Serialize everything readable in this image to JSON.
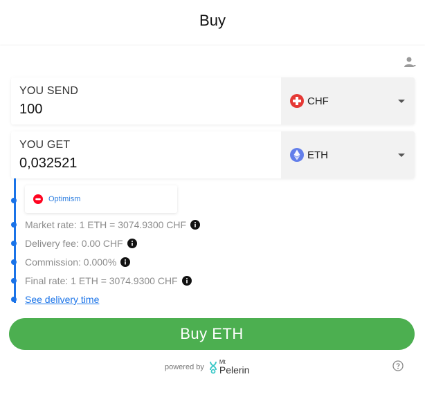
{
  "header": {
    "title": "Buy"
  },
  "send": {
    "label": "YOU SEND",
    "amount": "100",
    "currency": "CHF",
    "currency_icon": "swiss-flag-icon"
  },
  "get": {
    "label": "YOU GET",
    "amount": "0,032521",
    "currency": "ETH",
    "currency_icon": "ethereum-icon"
  },
  "network": {
    "name": "Optimism",
    "icon": "optimism-icon"
  },
  "details": {
    "market_rate": "Market rate: 1 ETH = 3074.9300 CHF",
    "delivery_fee": "Delivery fee: 0.00 CHF",
    "commission": "Commission: 0.000%",
    "final_rate": "Final rate: 1 ETH = 3074.9300 CHF",
    "delivery_time_link": "See delivery time"
  },
  "buy_button": {
    "label": "Buy ETH"
  },
  "footer": {
    "powered_by": "powered by",
    "brand_mt": "Mt",
    "brand_name": "Pelerin"
  },
  "colors": {
    "accent": "#1a73e8",
    "button": "#4caf50",
    "chf_red": "#e53935",
    "eth_blue": "#627eea",
    "op_red": "#ff0420"
  }
}
